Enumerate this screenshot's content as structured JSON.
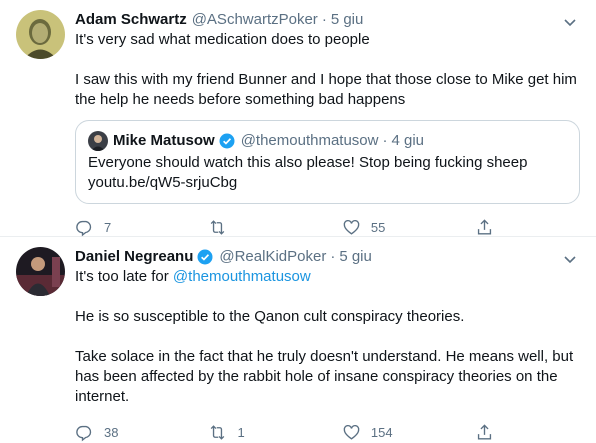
{
  "tweets": [
    {
      "author_name": "Adam Schwartz",
      "handle": "@ASchwartzPoker",
      "separator": "·",
      "time": "5 giu",
      "lines": [
        "It's very sad what medication does to people",
        "",
        "I saw this with my friend Bunner and I hope that those close to Mike get him",
        "the help he needs before something bad happens"
      ],
      "quote": {
        "author_name": "Mike Matusow",
        "handle": "@themouthmatusow",
        "separator": "·",
        "time": "4 giu",
        "line1": "Everyone should watch  this also please! Stop being fucking sheep",
        "line2": "youtu.be/qW5-srjuCbg"
      },
      "actions": {
        "replies": "7",
        "retweets": "",
        "likes": "55"
      }
    },
    {
      "author_name": "Daniel Negreanu",
      "handle": "@RealKidPoker",
      "separator": "·",
      "time": "5 giu",
      "reply_prefix": "It's too late for",
      "reply_mention": "@themouthmatusow",
      "lines": [
        "He is so susceptible to the Qanon cult conspiracy theories.",
        "Take solace in the fact that he truly doesn't understand. He means well, but",
        "has been affected by the rabbit hole of insane conspiracy theories on the",
        "internet."
      ],
      "actions": {
        "replies": "38",
        "retweets": "1",
        "likes": "154"
      }
    }
  ],
  "colors": {
    "text": "#0f1419",
    "secondary": "#5b7083",
    "link": "#1b95e0",
    "verified": "#1da1f2",
    "border": "#ccd6dd"
  }
}
